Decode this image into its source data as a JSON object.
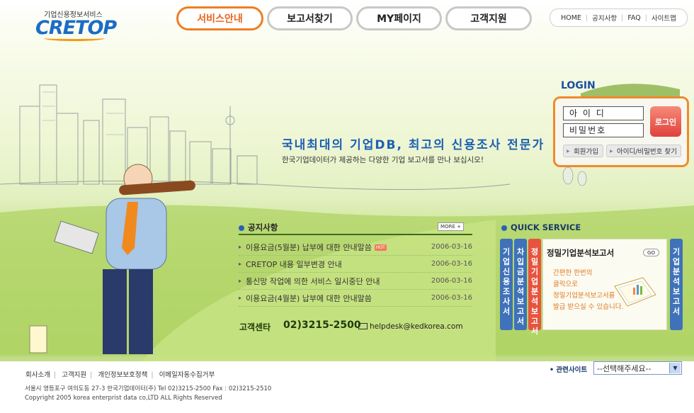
{
  "header": {
    "logo_sub": "기업신용정보서비스",
    "logo": "CRETOP",
    "nav": [
      {
        "label": "서비스안내",
        "active": true
      },
      {
        "label": "보고서찾기",
        "active": false
      },
      {
        "label": "MY페이지",
        "active": false
      },
      {
        "label": "고객지원",
        "active": false
      }
    ],
    "util": [
      "HOME",
      "공지사항",
      "FAQ",
      "사이트맵"
    ]
  },
  "hero": {
    "slogan": "국내최대의 기업DB, 최고의 신용조사 전문가",
    "sub": "한국기업데이터가 제공하는 다양한 기업 보고서를 만나 보십시오!"
  },
  "login": {
    "title": "LOGIN",
    "id_placeholder": "아 이 디",
    "pw_placeholder": "비밀번호",
    "login_button": "로그인",
    "join": "회원가입",
    "find": "아이디/비밀번호 찾기"
  },
  "notices": {
    "title": "공지사항",
    "more": "MORE +",
    "items": [
      {
        "title": "이용요금(5월분) 납부에 대한 안내말씀",
        "hot": "HOT",
        "date": "2006-03-16"
      },
      {
        "title": "CRETOP 내용 일부변경 안내",
        "hot": "",
        "date": "2006-03-16"
      },
      {
        "title": "통신망 작업에 의한 서비스 일시중단 안내",
        "hot": "",
        "date": "2006-03-16"
      },
      {
        "title": "이용요금(4월분) 납부에 대한 안내말씀",
        "hot": "",
        "date": "2006-03-16"
      }
    ],
    "cs_label": "고객센타",
    "cs_phone": "02)3215-2500",
    "cs_mail": "helpdesk@kedkorea.com"
  },
  "quick": {
    "title": "QUICK SERVICE",
    "tabs": [
      "기업신용조사서",
      "차입금분석보고서",
      "정밀기업분석보고서",
      "기업분석보고서"
    ],
    "panel_title": "정밀기업분석보고서",
    "go": "GO",
    "desc": [
      "간편한 한번의",
      "클릭으로",
      "정밀기업분석보고서를",
      "발급 받으실 수 있습니다."
    ]
  },
  "footer": {
    "links": [
      "회사소개",
      "고객지원",
      "개인정보보호정책",
      "이메일자동수집거부"
    ],
    "address": "서울시 영등포구 여의도동 27-3 한국기업데이터(주) Tel 02)3215-2500 Fax : 02)3215-2510",
    "copyright": "Copyright 2005 korea enterprist data co,LTD ALL Rights Reserved",
    "related_label": "관련사이트",
    "select_value": "--선택해주세요--"
  },
  "colors": {
    "brand": "#1b6cc6",
    "accent": "#ef7d22",
    "tab_blue": "#3f72b9",
    "tab_red": "#e8533e"
  }
}
